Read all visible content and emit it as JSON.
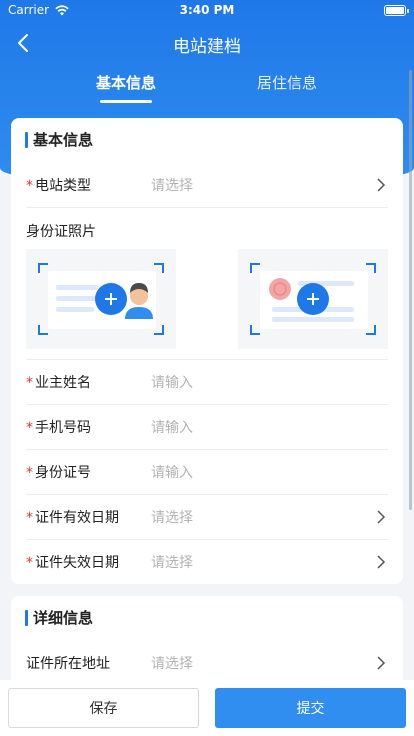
{
  "status_bar": {
    "carrier": "Carrier",
    "time": "3:40 PM"
  },
  "nav": {
    "title": "电站建档"
  },
  "tabs": [
    {
      "label": "基本信息",
      "active": true
    },
    {
      "label": "居住信息",
      "active": false
    }
  ],
  "basic": {
    "section_title": "基本信息",
    "station_type": {
      "required_mark": "*",
      "label": "电站类型",
      "placeholder": "请选择"
    },
    "id_photo_label": "身份证照片",
    "owner_name": {
      "required_mark": "*",
      "label": "业主姓名",
      "placeholder": "请输入"
    },
    "phone": {
      "required_mark": "*",
      "label": "手机号码",
      "placeholder": "请输入"
    },
    "id_number": {
      "required_mark": "*",
      "label": "身份证号",
      "placeholder": "请输入"
    },
    "valid_date": {
      "required_mark": "*",
      "label": "证件有效日期",
      "placeholder": "请选择"
    },
    "expire_date": {
      "required_mark": "*",
      "label": "证件失效日期",
      "placeholder": "请选择"
    }
  },
  "detail": {
    "section_title": "详细信息",
    "id_address": {
      "label": "证件所在地址",
      "placeholder": "请选择"
    }
  },
  "footer": {
    "save_label": "保存",
    "submit_label": "提交"
  },
  "colors": {
    "primary": "#1f78e8",
    "required": "#ee3333",
    "placeholder": "#b3b3b3"
  }
}
